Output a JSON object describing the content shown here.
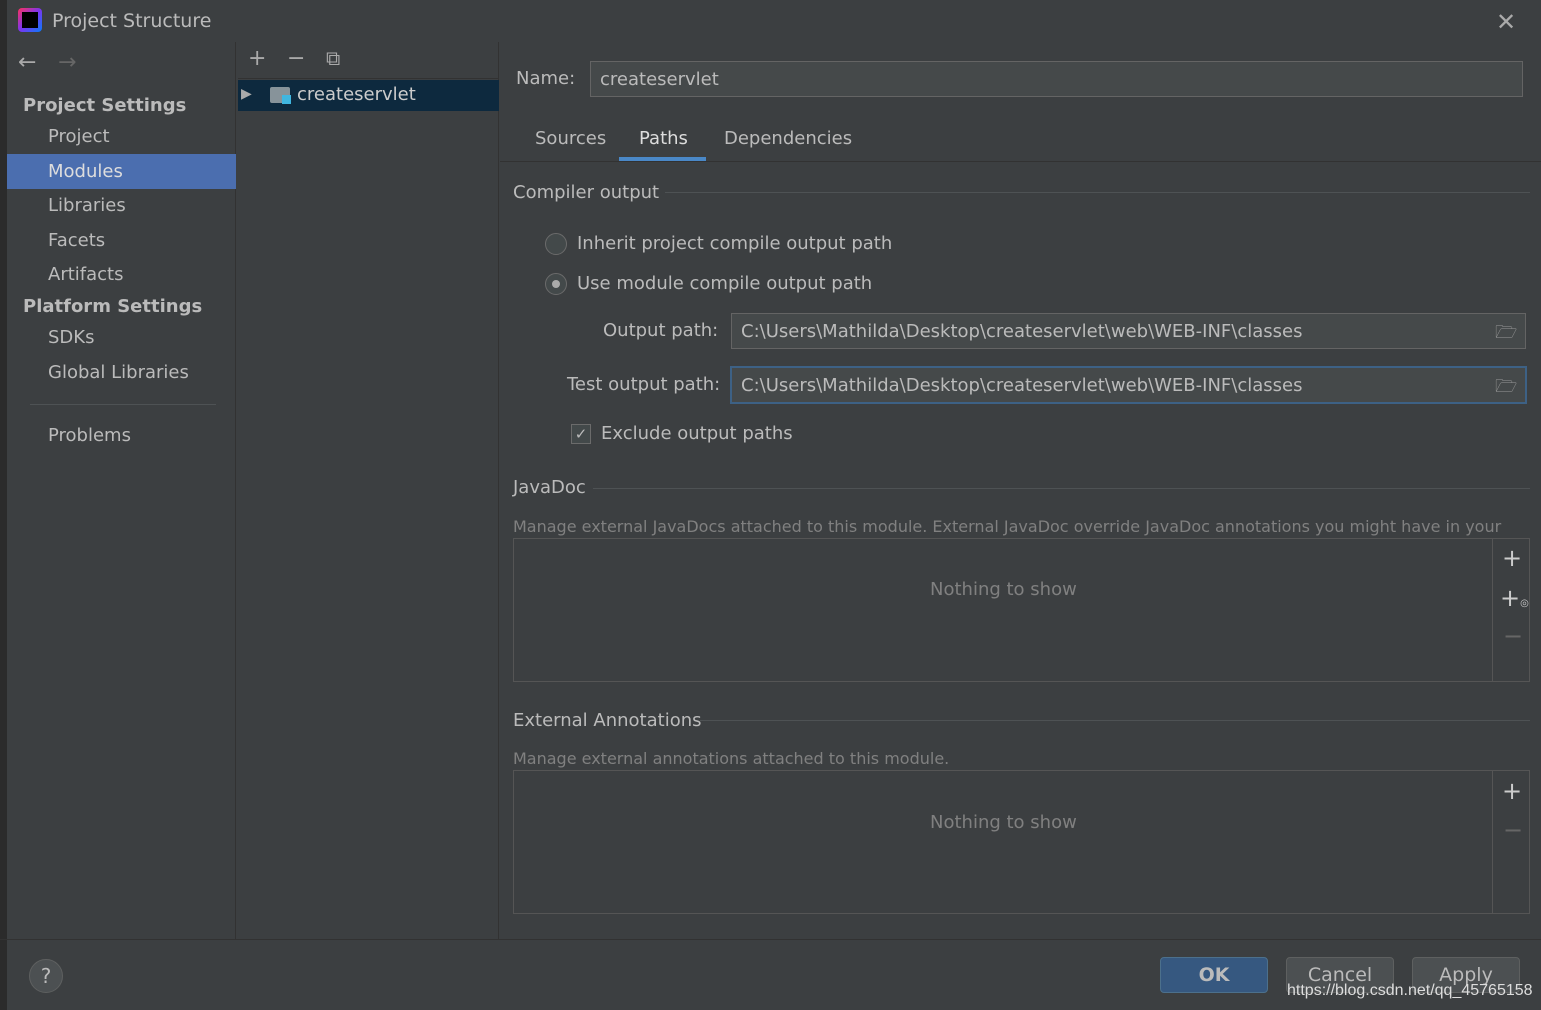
{
  "window": {
    "title": "Project Structure"
  },
  "sidebar": {
    "project_settings": "Project Settings",
    "items": [
      "Project",
      "Modules",
      "Libraries",
      "Facets",
      "Artifacts"
    ],
    "platform_settings": "Platform Settings",
    "platform_items": [
      "SDKs",
      "Global Libraries"
    ],
    "problems": "Problems",
    "selected": "Modules"
  },
  "tree": {
    "module": "createservlet"
  },
  "main": {
    "name_label": "Name:",
    "name_value": "createservlet",
    "tabs": [
      "Sources",
      "Paths",
      "Dependencies"
    ],
    "active_tab": "Paths",
    "compiler_output": "Compiler output",
    "radio_inherit": "Inherit project compile output path",
    "radio_module": "Use module compile output path",
    "output_label": "Output path:",
    "output_value": "C:\\Users\\Mathilda\\Desktop\\createservlet\\web\\WEB-INF\\classes",
    "test_label": "Test output path:",
    "test_value": "C:\\Users\\Mathilda\\Desktop\\createservlet\\web\\WEB-INF\\classes",
    "exclude": "Exclude output paths",
    "exclude_checked": true,
    "javadoc": "JavaDoc",
    "javadoc_hint": "Manage external JavaDocs attached to this module. External JavaDoc override JavaDoc annotations you might have in your module.",
    "empty": "Nothing to show",
    "ext_ann": "External Annotations",
    "ext_hint": "Manage external annotations attached to this module."
  },
  "footer": {
    "ok": "OK",
    "cancel": "Cancel",
    "apply": "Apply",
    "watermark": "https://blog.csdn.net/qq_45765158"
  }
}
